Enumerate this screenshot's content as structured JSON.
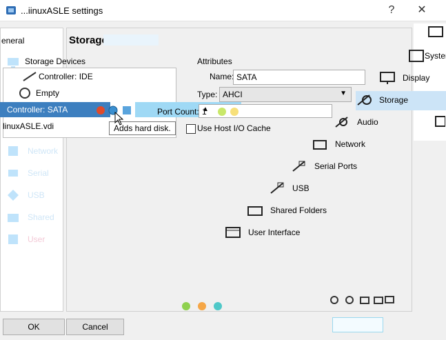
{
  "window": {
    "title": "...iinuxASLE settings",
    "help_label": "?",
    "close_label": "✕"
  },
  "nav": {
    "general_label": "eneral",
    "items": [
      {
        "label": "Display",
        "icon": "display-icon"
      },
      {
        "label": "Storage",
        "icon": "storage-icon"
      },
      {
        "label": "Audio",
        "icon": "audio-icon"
      },
      {
        "label": "Network",
        "icon": "network-icon"
      },
      {
        "label": "Serial",
        "icon": "serial-icon"
      },
      {
        "label": "USB",
        "icon": "usb-icon"
      },
      {
        "label": "Shared",
        "icon": "shared-icon"
      },
      {
        "label": "User",
        "icon": "user-icon"
      }
    ]
  },
  "page": {
    "title": "Storage",
    "storage_devices_label": "Storage Devices",
    "attributes_label": "Attributes"
  },
  "tree": [
    {
      "label": "Controller: IDE",
      "indent": 0,
      "selected": false
    },
    {
      "label": "Empty",
      "indent": 1,
      "selected": false
    },
    {
      "label": "Controller: SATA",
      "indent": 0,
      "selected": true
    },
    {
      "label": "linuxASLE.vdi",
      "indent": 1,
      "selected": false
    }
  ],
  "attributes": {
    "name_label": "Name:",
    "name_value": "SATA",
    "type_label": "Type:",
    "type_value": "AHCI",
    "port_count_label": "Port Count:",
    "port_count_value": "1",
    "use_host_cache_label": "Use Host I/O Cache"
  },
  "tooltip": {
    "text": "Adds hard disk."
  },
  "categories": [
    {
      "label": "System",
      "icon": "system-icon",
      "selected": false
    },
    {
      "label": "Display",
      "icon": "display-icon",
      "selected": false
    },
    {
      "label": "Storage",
      "icon": "storage-icon",
      "selected": true
    },
    {
      "label": "Audio",
      "icon": "audio-icon",
      "selected": false
    },
    {
      "label": "Network",
      "icon": "network-icon",
      "selected": false
    },
    {
      "label": "Serial Ports",
      "icon": "serial-ports-icon",
      "selected": false
    },
    {
      "label": "USB",
      "icon": "usb-icon",
      "selected": false
    },
    {
      "label": "Shared Folders",
      "icon": "shared-folders-icon",
      "selected": false
    },
    {
      "label": "User Interface",
      "icon": "user-interface-icon",
      "selected": false
    }
  ],
  "buttons": {
    "ok_label": "OK",
    "cancel_label": "Cancel"
  },
  "colors": {
    "selection_blue": "#3d7fbf",
    "category_selected": "#cce4f7",
    "dot_green": "#8fd14f",
    "dot_orange": "#f5a646",
    "dot_teal": "#4fc8c8"
  }
}
